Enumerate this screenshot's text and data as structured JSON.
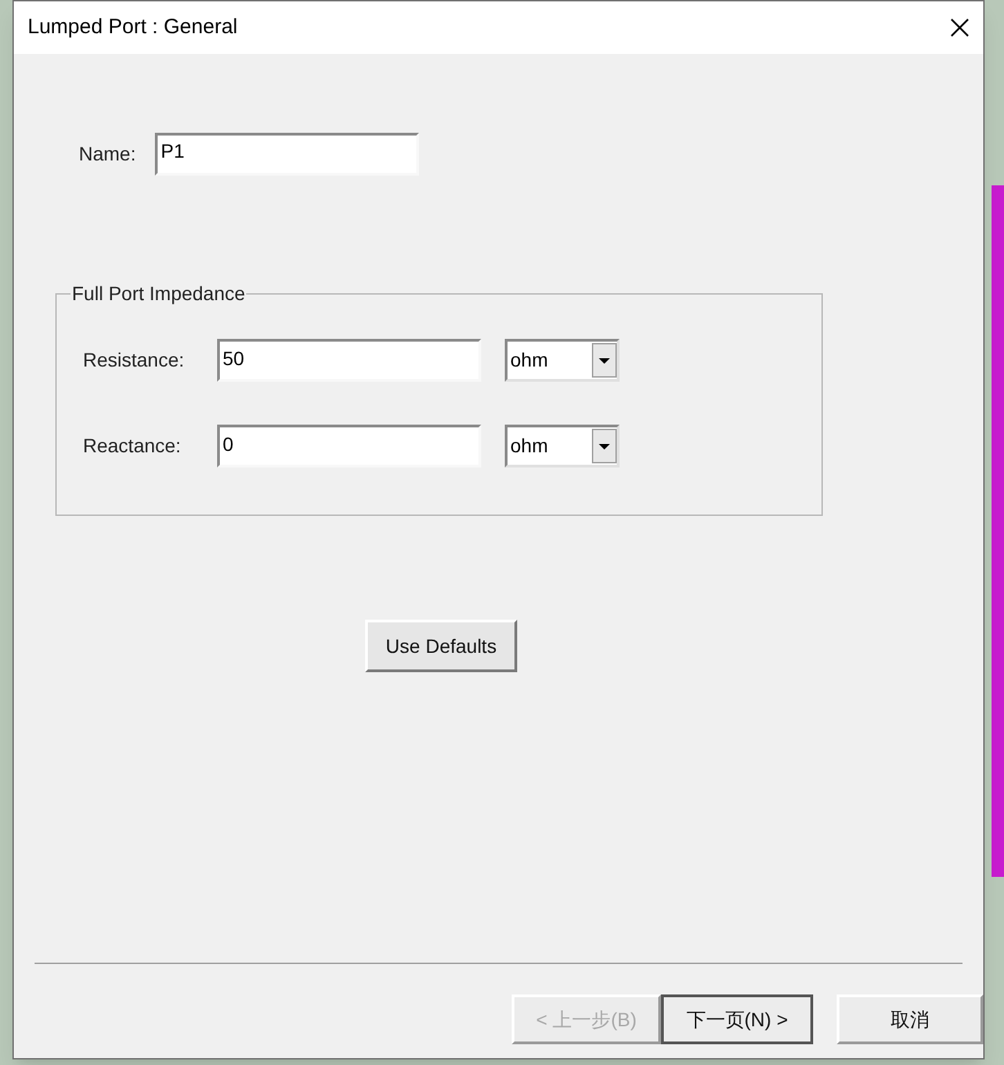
{
  "window": {
    "title": "Lumped Port : General"
  },
  "name_field": {
    "label": "Name:",
    "value": "P1"
  },
  "group": {
    "title": "Full Port Impedance",
    "rows": [
      {
        "label": "Resistance:",
        "value": "50",
        "unit": "ohm"
      },
      {
        "label": "Reactance:",
        "value": "0",
        "unit": "ohm"
      }
    ]
  },
  "use_defaults_button": "Use Defaults",
  "footer_buttons": [
    {
      "label": "< 上一步(B)",
      "disabled": true,
      "default": false
    },
    {
      "label": "下一页(N) >",
      "disabled": false,
      "default": true
    },
    {
      "label": "取消",
      "disabled": false,
      "default": false
    }
  ]
}
